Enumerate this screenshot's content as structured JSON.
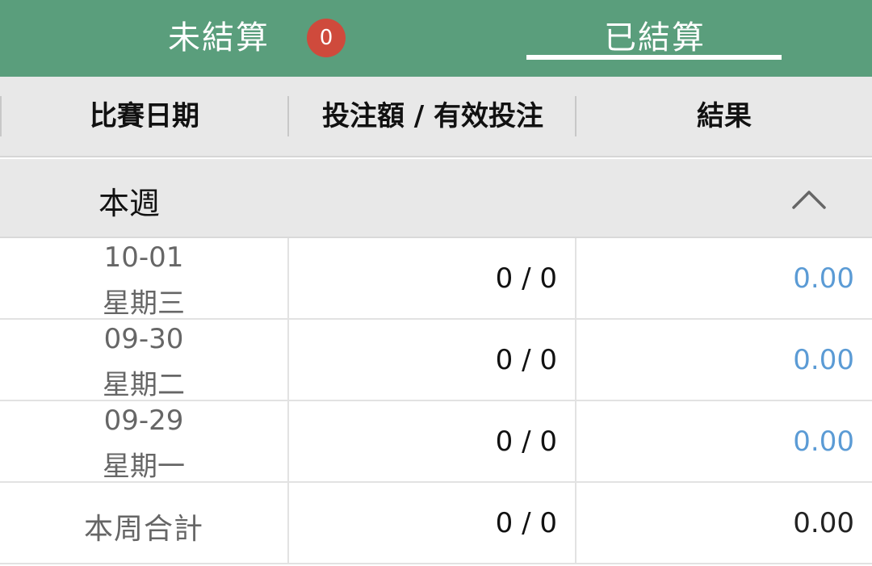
{
  "tabs": {
    "unsettled": {
      "label": "未結算",
      "badge": "0"
    },
    "settled": {
      "label": "已結算"
    }
  },
  "table": {
    "headers": [
      "比賽日期",
      "投注額 / 有效投注",
      "結果"
    ],
    "group": {
      "title": "本週",
      "state_icon": "chevron-up-icon"
    },
    "rows": [
      {
        "date": "10-01",
        "weekday": "星期三",
        "bet": "0 / 0",
        "result": "0.00"
      },
      {
        "date": "09-30",
        "weekday": "星期二",
        "bet": "0 / 0",
        "result": "0.00"
      },
      {
        "date": "09-29",
        "weekday": "星期一",
        "bet": "0 / 0",
        "result": "0.00"
      }
    ],
    "total": {
      "label": "本周合計",
      "bet": "0 / 0",
      "result": "0.00"
    }
  },
  "colors": {
    "tabbar": "#5a9e7c",
    "badge": "#cf4a3c",
    "result_link": "#5b9bd5",
    "header_bg": "#e8e8e8"
  }
}
